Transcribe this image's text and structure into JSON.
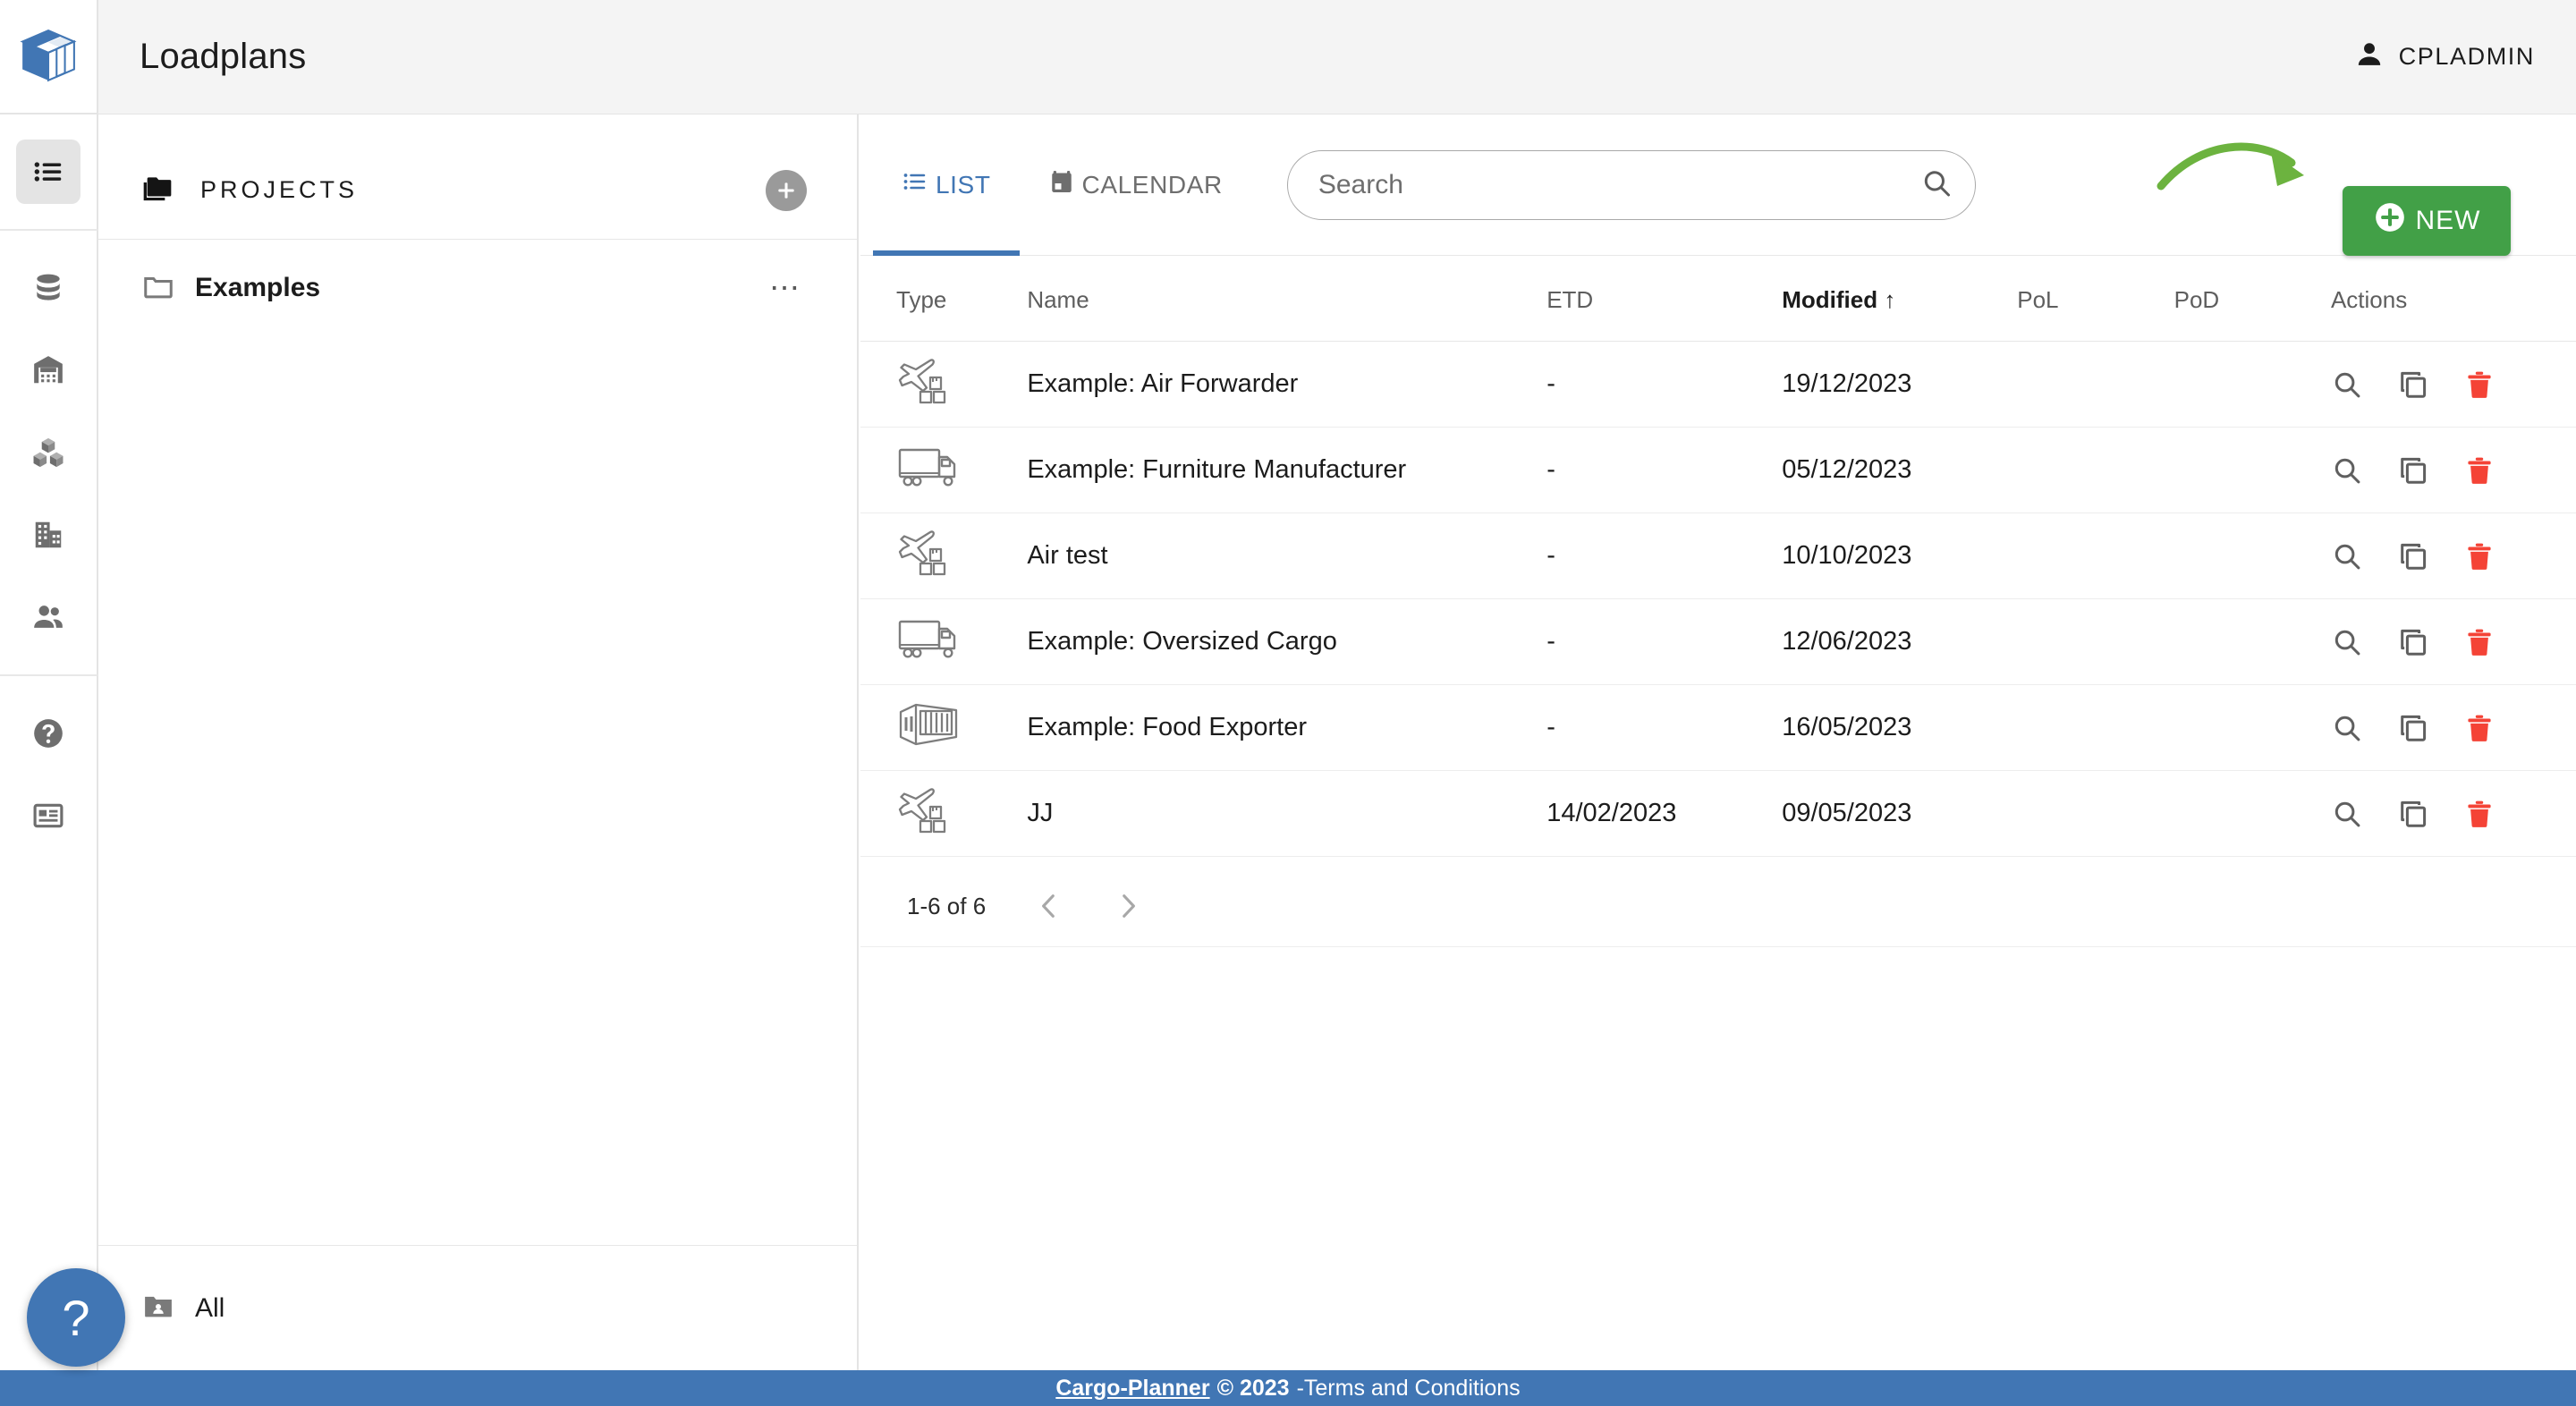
{
  "header": {
    "title": "Loadplans",
    "user_name": "CPLADMIN",
    "user_icon": "person-icon"
  },
  "rail": {
    "logo_icon": "cargo-planner-box-logo",
    "items": [
      {
        "icon": "list-icon",
        "name": "loadplans",
        "active": true
      },
      {
        "icon": "database-icon",
        "name": "cargo-library",
        "active": false
      },
      {
        "icon": "warehouse-icon",
        "name": "warehouse",
        "active": false
      },
      {
        "icon": "boxes-icon",
        "name": "equipment",
        "active": false
      },
      {
        "icon": "building-icon",
        "name": "company",
        "active": false
      },
      {
        "icon": "users-icon",
        "name": "users",
        "active": false
      },
      {
        "icon": "help-circle-icon",
        "name": "help",
        "active": false
      },
      {
        "icon": "article-icon",
        "name": "news",
        "active": false
      }
    ]
  },
  "projects": {
    "title": "PROJECTS",
    "title_icon": "folders-icon",
    "add_button_icon": "plus-icon",
    "folders": [
      {
        "name": "Examples",
        "icon": "folder-icon",
        "menu_icon": "more-horizontal-icon"
      }
    ],
    "all_label": "All",
    "all_icon": "folder-shared-icon"
  },
  "main": {
    "tabs": [
      {
        "label": "LIST",
        "icon": "list-icon",
        "active": true
      },
      {
        "label": "CALENDAR",
        "icon": "calendar-icon",
        "active": false
      }
    ],
    "search": {
      "placeholder": "Search",
      "value": "",
      "icon": "search-icon"
    },
    "new_button": {
      "label": "NEW",
      "icon": "plus-circle-icon",
      "color": "#42a047"
    },
    "annotation_arrow": {
      "name": "green-curved-arrow",
      "color": "#6cb33f"
    },
    "table": {
      "columns": [
        {
          "key": "type",
          "label": "Type",
          "sorted": false
        },
        {
          "key": "name",
          "label": "Name",
          "sorted": false
        },
        {
          "key": "etd",
          "label": "ETD",
          "sorted": false
        },
        {
          "key": "modified",
          "label": "Modified",
          "sorted": true,
          "sort_icon": "↑"
        },
        {
          "key": "pol",
          "label": "PoL",
          "sorted": false
        },
        {
          "key": "pod",
          "label": "PoD",
          "sorted": false
        },
        {
          "key": "actions",
          "label": "Actions",
          "sorted": false
        }
      ],
      "rows": [
        {
          "type_icon": "airplane-cargo-icon",
          "name": "Example: Air Forwarder",
          "etd": "-",
          "modified": "19/12/2023",
          "pol": "",
          "pod": ""
        },
        {
          "type_icon": "truck-icon",
          "name": "Example: Furniture Manufacturer",
          "etd": "-",
          "modified": "05/12/2023",
          "pol": "",
          "pod": ""
        },
        {
          "type_icon": "airplane-cargo-icon",
          "name": "Air test",
          "etd": "-",
          "modified": "10/10/2023",
          "pol": "",
          "pod": ""
        },
        {
          "type_icon": "truck-icon",
          "name": "Example: Oversized Cargo",
          "etd": "-",
          "modified": "12/06/2023",
          "pol": "",
          "pod": ""
        },
        {
          "type_icon": "container-icon",
          "name": "Example: Food Exporter",
          "etd": "-",
          "modified": "16/05/2023",
          "pol": "",
          "pod": ""
        },
        {
          "type_icon": "airplane-cargo-icon",
          "name": "JJ",
          "etd": "14/02/2023",
          "modified": "09/05/2023",
          "pol": "",
          "pod": ""
        }
      ],
      "row_actions": [
        {
          "icon": "magnifier-icon",
          "name": "preview"
        },
        {
          "icon": "copy-icon",
          "name": "duplicate"
        },
        {
          "icon": "trash-icon",
          "name": "delete",
          "color": "#f44336"
        }
      ],
      "pagination": {
        "range_label": "1-6 of 6",
        "prev_icon": "chevron-left-icon",
        "next_icon": "chevron-right-icon"
      }
    }
  },
  "footer": {
    "brand": "Cargo-Planner",
    "copyright": "© 2023",
    "separator": "-",
    "terms": "Terms and Conditions",
    "background": "#4176b4"
  },
  "fab": {
    "label": "?",
    "name": "help-fab",
    "color": "#4176b4"
  }
}
